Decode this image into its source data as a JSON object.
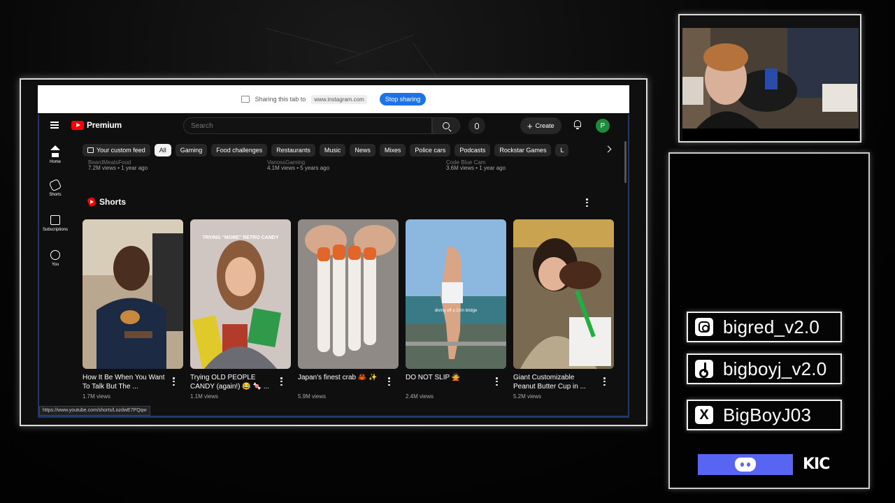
{
  "share_bar": {
    "message": "Sharing this tab to",
    "target": "www.instagram.com",
    "stop_label": "Stop sharing"
  },
  "youtube": {
    "brand": "Premium",
    "search_placeholder": "Search",
    "create_label": "Create",
    "avatar_letter": "P",
    "sidebar": [
      {
        "label": "Home",
        "icon": "home-icon"
      },
      {
        "label": "Shorts",
        "icon": "shorts-icon"
      },
      {
        "label": "Subscriptions",
        "icon": "subscriptions-icon"
      },
      {
        "label": "You",
        "icon": "you-icon"
      }
    ],
    "chips": [
      "Your custom feed",
      "All",
      "Gaming",
      "Food challenges",
      "Restaurants",
      "Music",
      "News",
      "Mixes",
      "Police cars",
      "Podcasts",
      "Rockstar Games",
      "L"
    ],
    "active_chip": "All",
    "previous_row": [
      {
        "channel": "BeardMeatsFood",
        "meta": "7.2M views • 1 year ago"
      },
      {
        "channel": "VanossGaming",
        "meta": "4.1M views • 5 years ago"
      },
      {
        "channel": "Code Blue Cam",
        "meta": "3.6M views • 1 year ago"
      }
    ],
    "shorts_title": "Shorts",
    "shorts": [
      {
        "title": "How It Be When You Want To Talk But The ...",
        "views": "1.7M views"
      },
      {
        "title": "Trying OLD PEOPLE CANDY (again!) 😂 🍬 ...",
        "views": "1.1M views"
      },
      {
        "title": "Japan's finest crab 🦀 ✨",
        "views": "5.9M views"
      },
      {
        "title": "DO NOT SLIP 🙅",
        "views": "2.4M views"
      },
      {
        "title": "Giant Customizable Peanut Butter Cup in ...",
        "views": "5.2M views"
      }
    ],
    "thumb_overlays": {
      "candy": "TRYING \"MORE\" RETRO CANDY",
      "bridge": "diving off a 22m bridge"
    },
    "status_url": "https://www.youtube.com/shorts/LozdwE7PQqw"
  },
  "socials": {
    "instagram": "bigred_v2.0",
    "tiktok": "bigboyj_v2.0",
    "x": "BigBoyJ03",
    "kick": "KIC"
  },
  "colors": {
    "accent_blue": "#1a73e8",
    "youtube_red": "#ff0000",
    "discord": "#5865f2",
    "avatar": "#1e8a3c"
  }
}
